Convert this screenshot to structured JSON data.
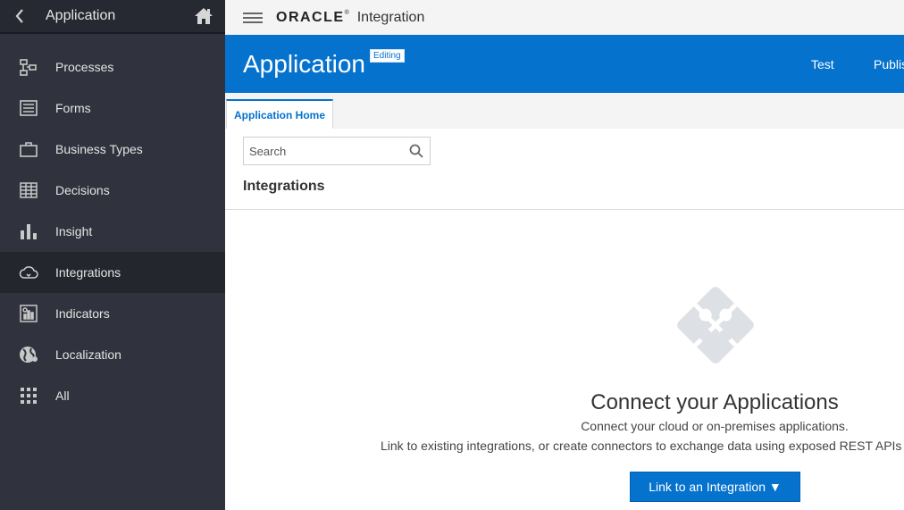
{
  "sidebar": {
    "title": "Application",
    "items": [
      {
        "label": "Processes",
        "icon": "processes-icon"
      },
      {
        "label": "Forms",
        "icon": "forms-icon"
      },
      {
        "label": "Business Types",
        "icon": "briefcase-icon"
      },
      {
        "label": "Decisions",
        "icon": "decision-table-icon"
      },
      {
        "label": "Insight",
        "icon": "bar-chart-icon"
      },
      {
        "label": "Integrations",
        "icon": "cloud-icon",
        "active": true
      },
      {
        "label": "Indicators",
        "icon": "indicators-icon"
      },
      {
        "label": "Localization",
        "icon": "globe-icon"
      },
      {
        "label": "All",
        "icon": "grid-icon"
      }
    ]
  },
  "topbar": {
    "brand": "ORACLE",
    "brand_mark": "®",
    "product": "Integration"
  },
  "banner": {
    "title": "Application",
    "badge": "Editing",
    "test_label": "Test",
    "publish_label": "Publis"
  },
  "tabs": [
    {
      "label": "Application Home",
      "active": true
    }
  ],
  "search": {
    "placeholder": "Search",
    "value": ""
  },
  "main": {
    "section_title": "Integrations",
    "empty_state": {
      "icon": "puzzle-icon",
      "title": "Connect your Applications",
      "description_1": "Connect your cloud or on-premises applications.",
      "description_2": "Link to existing integrations, or create connectors to exchange data using exposed REST APIs",
      "button_label": "Link to an Integration ▼"
    }
  },
  "colors": {
    "sidebar_bg": "#30333d",
    "sidebar_active_bg": "#23262d",
    "accent": "#0572ce",
    "topbar_bg": "#f4f4f4"
  }
}
